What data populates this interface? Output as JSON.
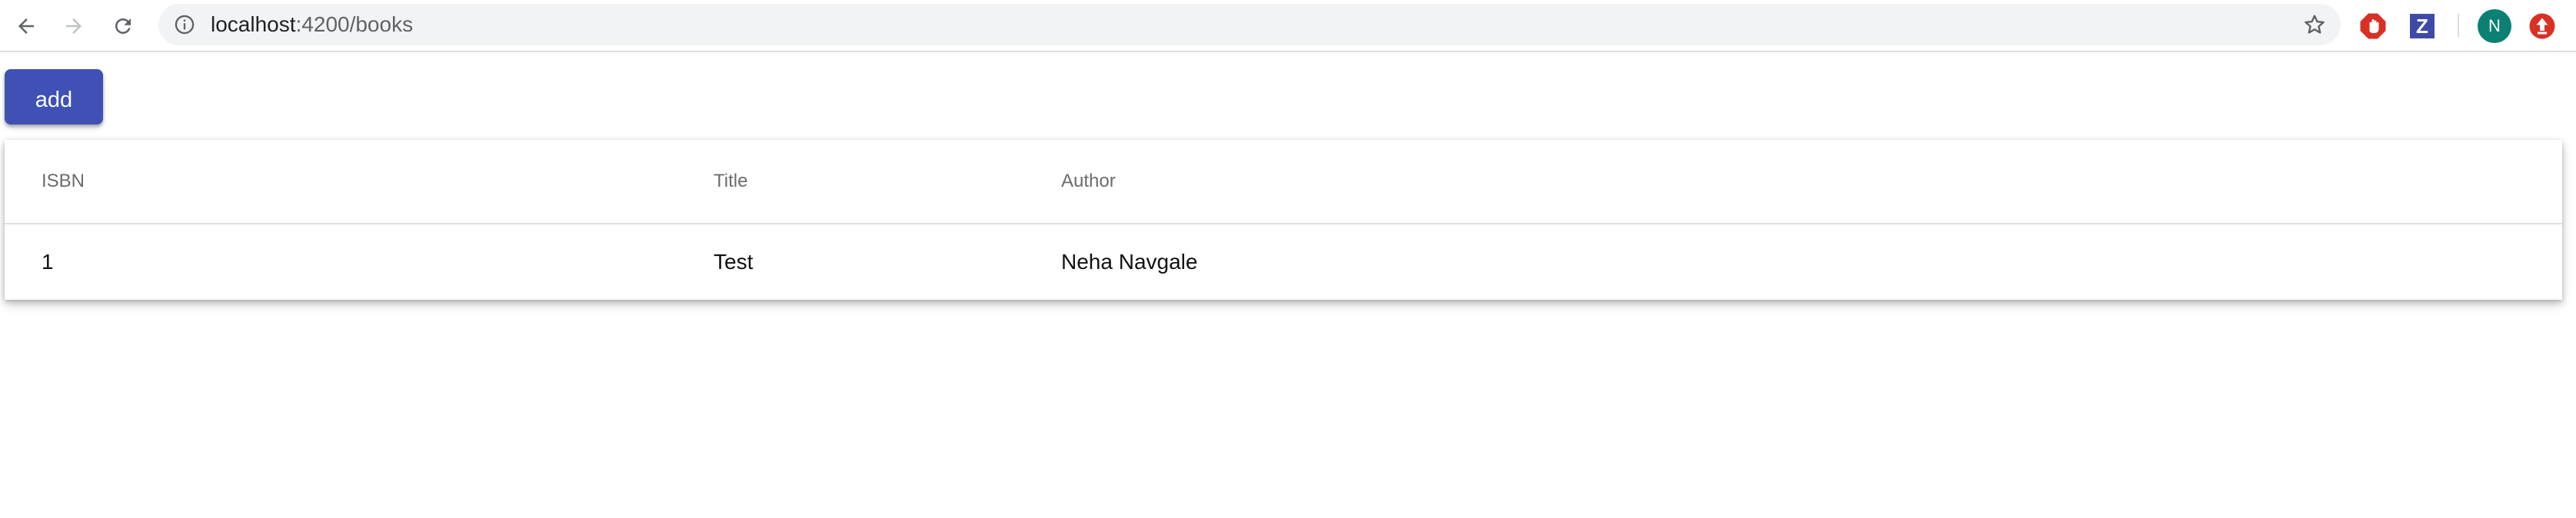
{
  "browser": {
    "url_host": "localhost",
    "url_rest": ":4200/books",
    "avatar_letter": "N",
    "extension_z_letter": "Z",
    "icons": {
      "back": "arrow-left-icon",
      "forward": "arrow-right-icon",
      "reload": "reload-icon",
      "info": "info-icon",
      "bookmark": "star-icon",
      "ext1": "red-hand-stop-icon",
      "ext2": "z-icon",
      "ext3": "red-upload-icon"
    },
    "colors": {
      "omnibox_bg": "#f1f3f4",
      "avatar_bg": "#0b8073"
    }
  },
  "page": {
    "add_button_label": "add",
    "add_button_color": "#3f51b5"
  },
  "table": {
    "headers": {
      "isbn": "ISBN",
      "title": "Title",
      "author": "Author"
    },
    "rows": [
      {
        "isbn": "1",
        "title": "Test",
        "author": "Neha Navgale"
      }
    ]
  }
}
